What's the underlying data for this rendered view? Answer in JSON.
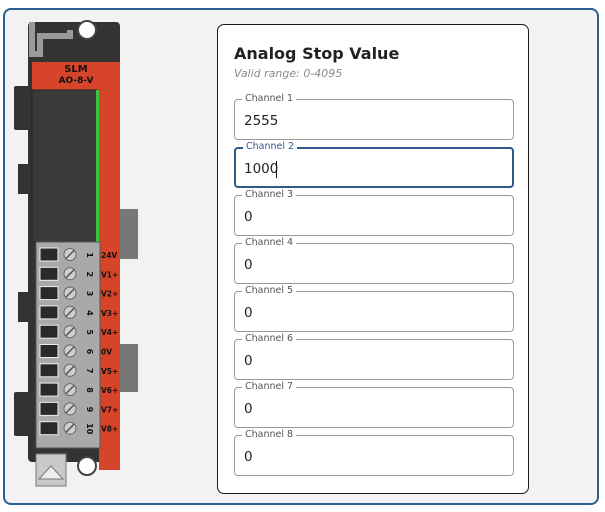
{
  "module": {
    "brand": "SLM",
    "model": "AO-8-V",
    "terminals": [
      {
        "number": "1",
        "label": "24V"
      },
      {
        "number": "2",
        "label": "V1+"
      },
      {
        "number": "3",
        "label": "V2+"
      },
      {
        "number": "4",
        "label": "V3+"
      },
      {
        "number": "5",
        "label": "V4+"
      },
      {
        "number": "6",
        "label": "0V"
      },
      {
        "number": "7",
        "label": "V5+"
      },
      {
        "number": "8",
        "label": "V6+"
      },
      {
        "number": "9",
        "label": "V7+"
      },
      {
        "number": "10",
        "label": "V8+"
      }
    ]
  },
  "panel": {
    "title": "Analog Stop Value",
    "subtitle": "Valid range: 0-4095",
    "channels": [
      {
        "label": "Channel 1",
        "value": "2555"
      },
      {
        "label": "Channel 2",
        "value": "1000"
      },
      {
        "label": "Channel 3",
        "value": "0"
      },
      {
        "label": "Channel 4",
        "value": "0"
      },
      {
        "label": "Channel 5",
        "value": "0"
      },
      {
        "label": "Channel 6",
        "value": "0"
      },
      {
        "label": "Channel 7",
        "value": "0"
      },
      {
        "label": "Channel 8",
        "value": "0"
      }
    ],
    "focused_channel": "Channel 2"
  },
  "colors": {
    "frame_border": "#2b5f8f",
    "module_body": "#333333",
    "module_accent": "#d6452a",
    "focus": "#2e5a8a"
  }
}
